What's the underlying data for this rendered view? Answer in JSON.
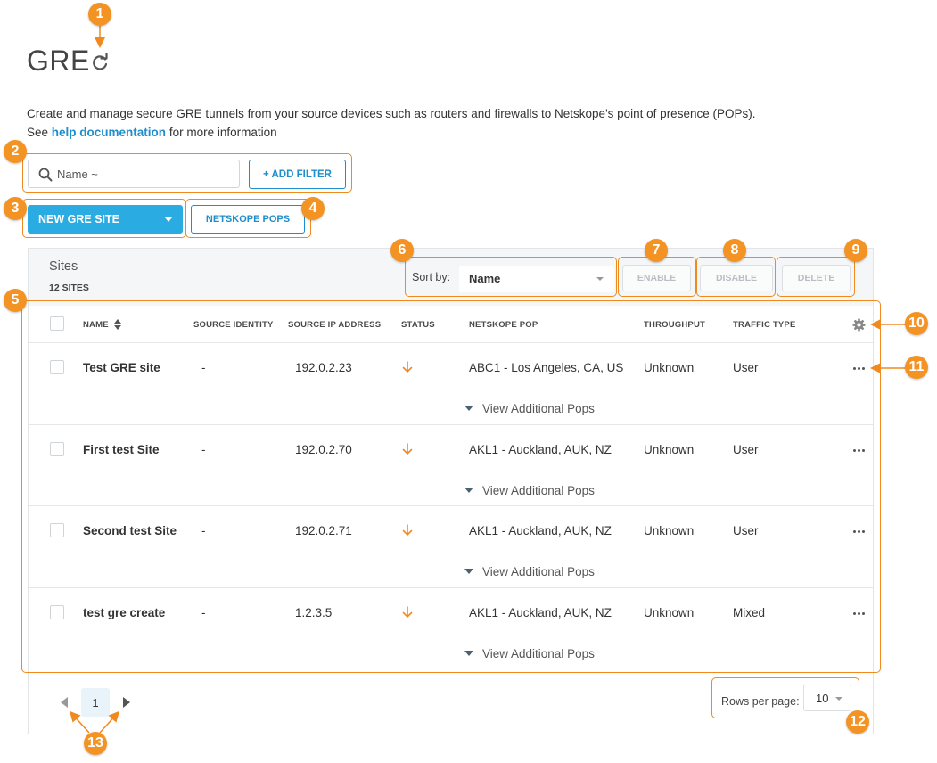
{
  "page": {
    "title": "GRE",
    "description_line1": "Create and manage secure GRE tunnels from your source devices such as routers and firewalls to Netskope's point of presence (POPs).",
    "desc_see": "See",
    "help_link": "help documentation",
    "desc_more": "for more information"
  },
  "filter": {
    "search_placeholder": "Name ~",
    "add_filter_label": "+ ADD FILTER"
  },
  "actions": {
    "new_site_label": "NEW GRE SITE",
    "netskope_pops_label": "NETSKOPE POPS"
  },
  "sites_panel": {
    "title": "Sites",
    "count": "12 SITES",
    "sort_by_label": "Sort by:",
    "sort_value": "Name",
    "enable_label": "ENABLE",
    "disable_label": "DISABLE",
    "delete_label": "DELETE"
  },
  "table": {
    "columns": [
      "NAME",
      "SOURCE IDENTITY",
      "SOURCE IP ADDRESS",
      "STATUS",
      "NETSKOPE POP",
      "THROUGHPUT",
      "TRAFFIC TYPE"
    ],
    "view_pops_label": "View Additional Pops",
    "rows": [
      {
        "name": "Test GRE site",
        "source_identity": "-",
        "source_ip": "192.0.2.23",
        "status": "down",
        "pop": "ABC1 - Los Angeles, CA, US",
        "throughput": "Unknown",
        "traffic_type": "User"
      },
      {
        "name": "First test Site",
        "source_identity": "-",
        "source_ip": "192.0.2.70",
        "status": "down",
        "pop": "AKL1 - Auckland, AUK, NZ",
        "throughput": "Unknown",
        "traffic_type": "User"
      },
      {
        "name": "Second test Site",
        "source_identity": "-",
        "source_ip": "192.0.2.71",
        "status": "down",
        "pop": "AKL1 - Auckland, AUK, NZ",
        "throughput": "Unknown",
        "traffic_type": "User"
      },
      {
        "name": "test gre create",
        "source_identity": "-",
        "source_ip": "1.2.3.5",
        "status": "down",
        "pop": "AKL1 - Auckland, AUK, NZ",
        "throughput": "Unknown",
        "traffic_type": "Mixed"
      }
    ]
  },
  "pagination": {
    "current_page": "1",
    "rows_per_page_label": "Rows per page:",
    "rows_per_page_value": "10"
  },
  "callouts": [
    "1",
    "2",
    "3",
    "4",
    "5",
    "6",
    "7",
    "8",
    "9",
    "10",
    "11",
    "12",
    "13"
  ],
  "colors": {
    "accent": "#2aace2",
    "link": "#1f8ecc",
    "callout": "#f39323",
    "status_down": "#f08a1e"
  },
  "icons": [
    "refresh-icon",
    "search-icon",
    "sort-icon",
    "status-down-arrow-icon",
    "gear-icon",
    "more-options-icon",
    "expand-triangle-icon",
    "chevron-left-icon",
    "chevron-right-icon"
  ]
}
